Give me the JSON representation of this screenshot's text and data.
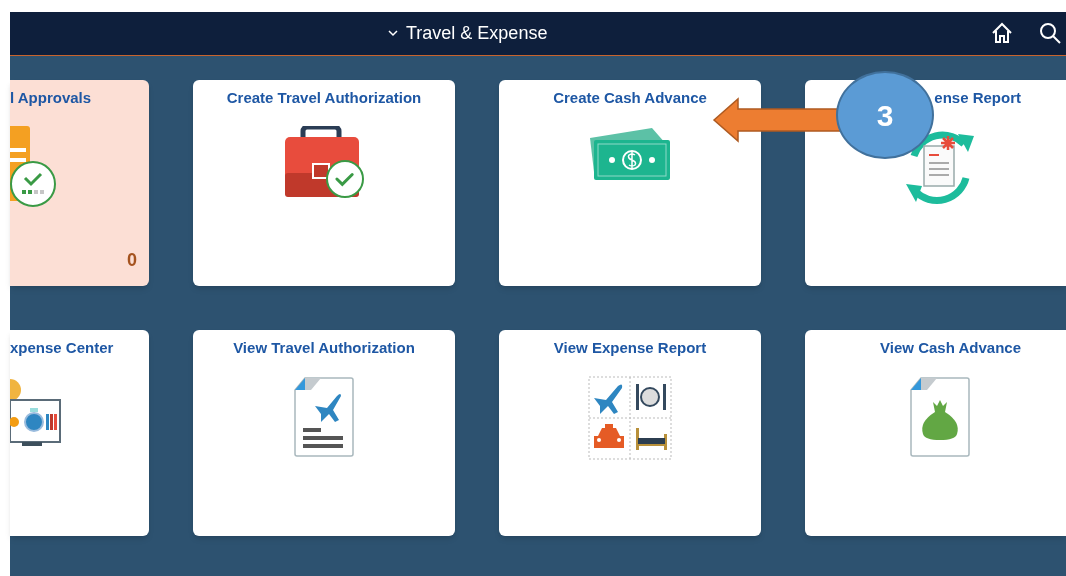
{
  "header": {
    "title": "Travel & Expense"
  },
  "tiles": [
    {
      "title": "l Approvals",
      "kind": "approvals",
      "count": "0",
      "highlighted": true
    },
    {
      "title": "Create Travel Authorization",
      "kind": "briefcase",
      "highlighted": false
    },
    {
      "title": "Create Cash Advance",
      "kind": "cash",
      "highlighted": false
    },
    {
      "title": "ense Report",
      "kind": "refresh-report",
      "highlighted": false
    },
    {
      "title": "xpense Center",
      "kind": "center",
      "highlighted": false
    },
    {
      "title": "View Travel Authorization",
      "kind": "travel-doc",
      "highlighted": false
    },
    {
      "title": "View Expense Report",
      "kind": "expense-grid",
      "highlighted": false
    },
    {
      "title": "View Cash Advance",
      "kind": "money-bag-doc",
      "highlighted": false
    }
  ],
  "callout": {
    "number": "3"
  }
}
